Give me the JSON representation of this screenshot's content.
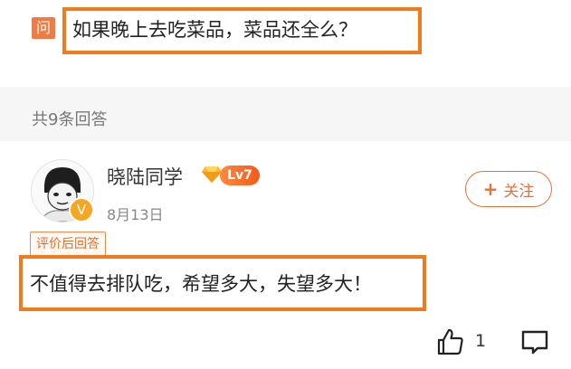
{
  "question": {
    "badge": "问",
    "text": "如果晚上去吃菜品，菜品还全么？"
  },
  "answers_summary": {
    "count_text": "共9条回答"
  },
  "answer": {
    "user_name": "晓陆同学",
    "level": "Lv7",
    "avatar_badge": "V",
    "date": "8月13日",
    "follow_label": "关注",
    "follow_plus": "+",
    "tag": "评价后回答",
    "text": "不值得去排队吃，希望多大，失望多大！",
    "like_count": "1"
  },
  "colors": {
    "highlight": "#f27a1c",
    "accent": "#e2733a",
    "badge": "#f07b43"
  },
  "icons": [
    "diamond-icon",
    "plus-icon",
    "thumbs-up-icon",
    "comment-icon"
  ]
}
